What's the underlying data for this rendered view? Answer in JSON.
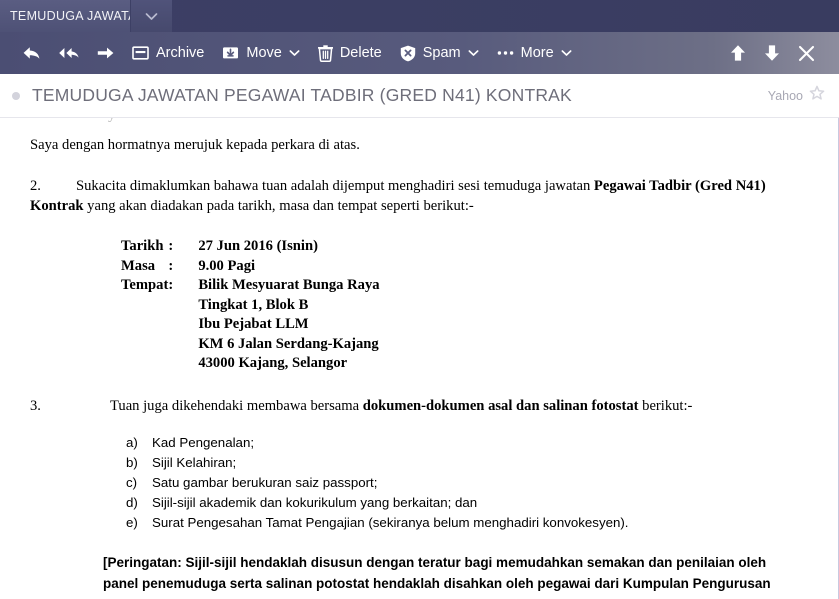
{
  "tab": {
    "title": "TEMUDUGA JAWATA",
    "caret_icon": "chevron-down-icon"
  },
  "toolbar": {
    "reply_icon": "reply-arrow-icon",
    "reply_all_icon": "reply-all-arrow-icon",
    "forward_icon": "forward-arrow-icon",
    "archive_label": "Archive",
    "archive_icon": "archive-box-icon",
    "move_label": "Move",
    "move_icon": "move-folder-icon",
    "move_caret_icon": "chevron-down-icon",
    "delete_label": "Delete",
    "delete_icon": "trash-icon",
    "spam_label": "Spam",
    "spam_icon": "spam-shield-icon",
    "spam_caret_icon": "chevron-down-icon",
    "more_label": "More",
    "more_icon": "ellipsis-icon",
    "more_caret_icon": "chevron-down-icon",
    "prev_icon": "arrow-up-icon",
    "next_icon": "arrow-down-icon",
    "close_icon": "close-x-icon"
  },
  "message_header": {
    "unread_indicator": "unread-dot",
    "subject": "TEMUDUGA JAWATAN PEGAWAI TADBIR (GRED N41) KONTRAK",
    "sender": "Yahoo",
    "star_icon": "star-outline-icon"
  },
  "message_body": {
    "ghost_fragment": "y",
    "intro": "Saya dengan hormatnya merujuk kepada perkara di atas.",
    "para2": {
      "number": "2.",
      "text_before": "Sukacita dimaklumkan bahawa tuan adalah dijemput menghadiri sesi temuduga jawatan ",
      "bold": "Pegawai Tadbir (Gred N41) Kontrak",
      "text_after": " yang akan diadakan pada tarikh, masa dan tempat seperti berikut:-"
    },
    "details": [
      {
        "label": "Tarikh",
        "colon": ":",
        "value": "27 Jun 2016 (Isnin)"
      },
      {
        "label": "Masa",
        "colon": ":",
        "value": "9.00 Pagi"
      },
      {
        "label": "Tempat",
        "colon": ":",
        "value": "Bilik Mesyuarat Bunga Raya"
      },
      {
        "label": "",
        "colon": "",
        "value": "Tingkat 1, Blok B"
      },
      {
        "label": "",
        "colon": "",
        "value": "Ibu Pejabat LLM"
      },
      {
        "label": "",
        "colon": "",
        "value": "KM 6 Jalan Serdang-Kajang"
      },
      {
        "label": "",
        "colon": "",
        "value": "43000 Kajang, Selangor"
      }
    ],
    "para3": {
      "number": "3.",
      "text_before": "Tuan juga dikehendaki membawa bersama ",
      "bold": "dokumen-dokumen asal dan salinan fotostat",
      "text_after": " berikut:-"
    },
    "documents": [
      {
        "marker": "a)",
        "text": "Kad Pengenalan;"
      },
      {
        "marker": "b)",
        "text": "Sijil Kelahiran;"
      },
      {
        "marker": "c)",
        "text": "Satu gambar berukuran saiz passport;"
      },
      {
        "marker": "d)",
        "text": "Sijil-sijil akademik dan kokurikulum yang berkaitan; dan"
      },
      {
        "marker": "e)",
        "text": "Surat Pengesahan Tamat Pengajian (sekiranya belum menghadiri konvokesyen)."
      }
    ],
    "note": "[Peringatan: Sijil-sijil hendaklah disusun dengan teratur bagi memudahkan semakan dan penilaian oleh panel penemuduga serta salinan potostat hendaklah disahkan oleh pegawai dari Kumpulan Pengurusan"
  },
  "colors": {
    "tab_strip": "#3b3e63",
    "tab_active": "#53567b",
    "toolbar_left": "#4b4e73",
    "toolbar_right": "#8d8d9e",
    "subject_text": "#6e6e7a",
    "sender_text": "#a8a8b4",
    "unread_dot": "#d3d3dc"
  }
}
